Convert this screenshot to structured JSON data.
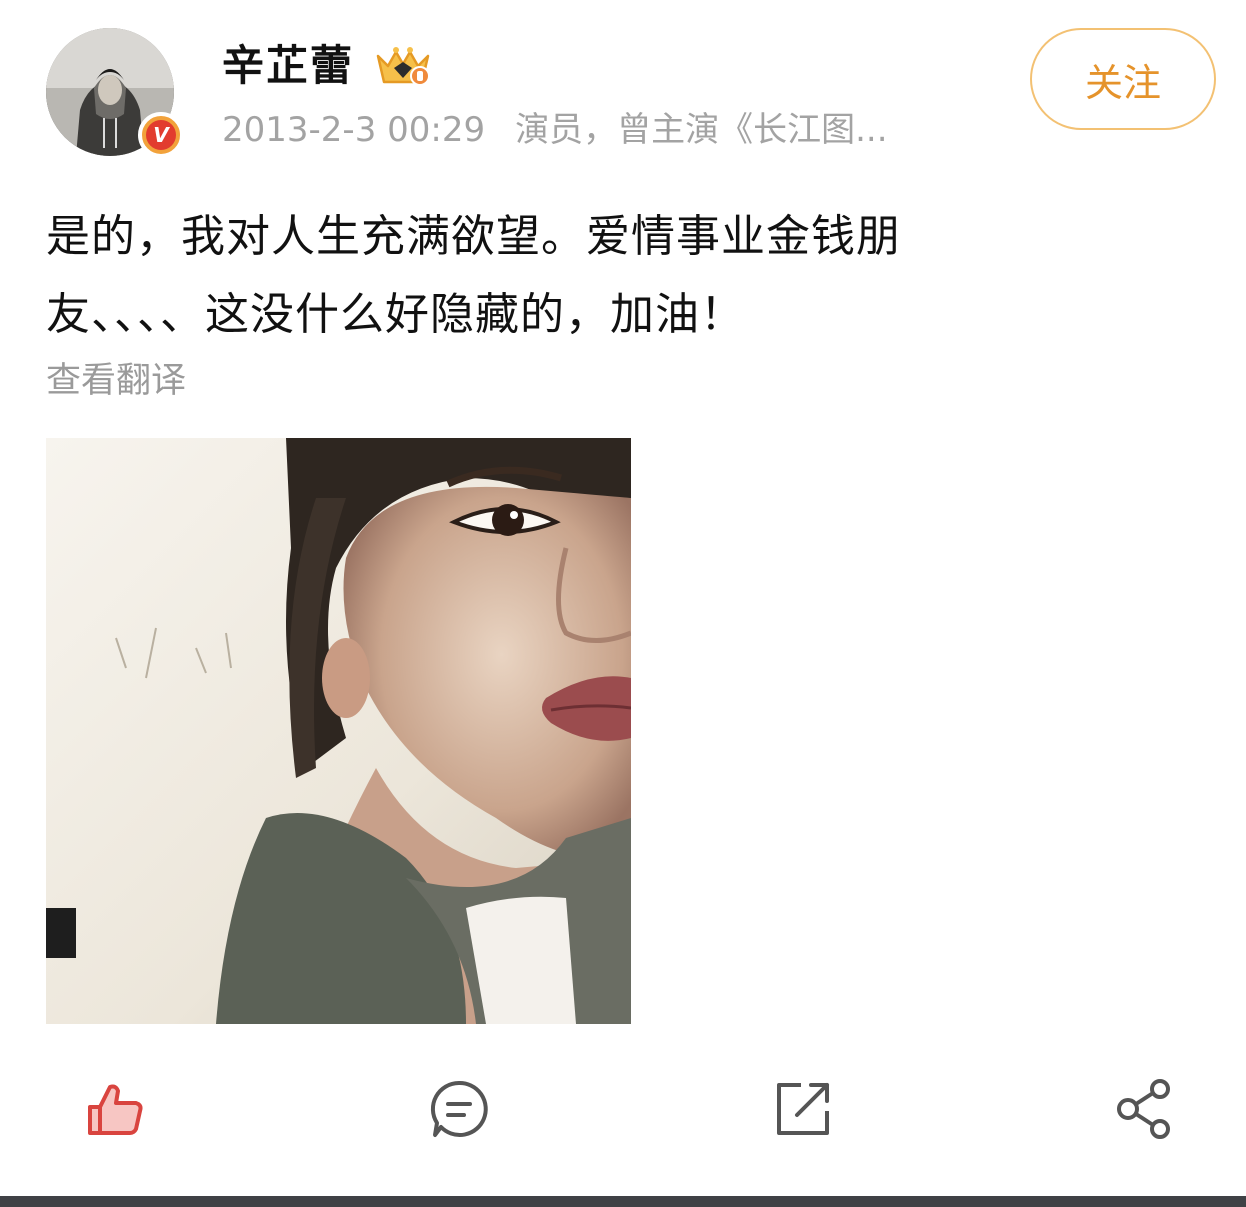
{
  "post": {
    "user": {
      "name": "辛芷蕾",
      "avatar_icon": "user-avatar-photo",
      "verified_badge_text": "V",
      "vip_icon": "crown-icon"
    },
    "meta": {
      "time": "2013-2-3 00:29",
      "bio": "演员，曾主演《长江图..."
    },
    "follow_label": "关注",
    "text_lines": [
      "是的，我对人生充满欲望。爱情事业金钱朋",
      "友、、、、这没什么好隐藏的，加油！"
    ],
    "translate_label": "查看翻译",
    "image_icon": "portrait-photo"
  },
  "actions": {
    "like_icon": "thumbs-up-icon",
    "comment_icon": "comment-icon",
    "repost_icon": "repost-icon",
    "share_icon": "share-icon"
  },
  "colors": {
    "follow_border": "#f3c173",
    "follow_text": "#e5932b",
    "meta_text": "#a3a3a3",
    "like_icon": "#d9443f",
    "action_icon": "#555555"
  }
}
